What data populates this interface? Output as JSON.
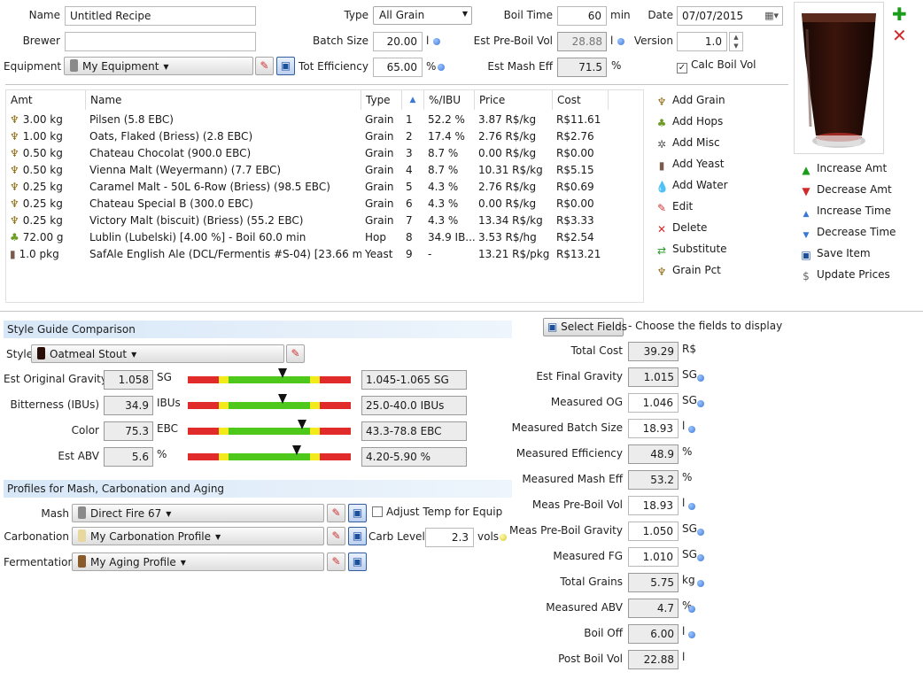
{
  "header": {
    "name_label": "Name",
    "name_value": "Untitled Recipe",
    "brewer_label": "Brewer",
    "brewer_value": "",
    "equipment_label": "Equipment",
    "equipment_value": "My Equipment",
    "type_label": "Type",
    "type_value": "All Grain",
    "batch_size_label": "Batch Size",
    "batch_size_value": "20.00",
    "batch_size_unit": "l",
    "tot_eff_label": "Tot Efficiency",
    "tot_eff_value": "65.00",
    "tot_eff_unit": "%",
    "boil_time_label": "Boil Time",
    "boil_time_value": "60",
    "boil_time_unit": "min",
    "pre_boil_label": "Est Pre-Boil Vol",
    "pre_boil_value": "28.88",
    "pre_boil_unit": "l",
    "mash_eff_label": "Est Mash Eff",
    "mash_eff_value": "71.5",
    "mash_eff_unit": "%",
    "date_label": "Date",
    "date_value": "07/07/2015",
    "version_label": "Version",
    "version_value": "1.0",
    "calc_boil_label": "Calc Boil Vol",
    "calc_boil_checked": "✓"
  },
  "ingredients": {
    "columns": [
      "Amt",
      "Name",
      "Type",
      "▲",
      "%/IBU",
      "Price",
      "Cost"
    ],
    "rows": [
      {
        "icon": "grain-icon",
        "amt": "3.00 kg",
        "name": "Pilsen (5.8 EBC)",
        "type": "Grain",
        "num": "1",
        "pct": "52.2 %",
        "price": "3.87 R$/kg",
        "cost": "R$11.61"
      },
      {
        "icon": "grain-icon",
        "amt": "1.00 kg",
        "name": "Oats, Flaked (Briess) (2.8 EBC)",
        "type": "Grain",
        "num": "2",
        "pct": "17.4 %",
        "price": "2.76 R$/kg",
        "cost": "R$2.76"
      },
      {
        "icon": "grain-icon",
        "amt": "0.50 kg",
        "name": "Chateau Chocolat (900.0 EBC)",
        "type": "Grain",
        "num": "3",
        "pct": "8.7 %",
        "price": "0.00 R$/kg",
        "cost": "R$0.00"
      },
      {
        "icon": "grain-icon",
        "amt": "0.50 kg",
        "name": "Vienna Malt (Weyermann) (7.7 EBC)",
        "type": "Grain",
        "num": "4",
        "pct": "8.7 %",
        "price": "10.31 R$/kg",
        "cost": "R$5.15"
      },
      {
        "icon": "grain-icon",
        "amt": "0.25 kg",
        "name": "Caramel Malt - 50L 6-Row (Briess) (98.5 EBC)",
        "type": "Grain",
        "num": "5",
        "pct": "4.3 %",
        "price": "2.76 R$/kg",
        "cost": "R$0.69"
      },
      {
        "icon": "grain-icon",
        "amt": "0.25 kg",
        "name": "Chateau Special B (300.0 EBC)",
        "type": "Grain",
        "num": "6",
        "pct": "4.3 %",
        "price": "0.00 R$/kg",
        "cost": "R$0.00"
      },
      {
        "icon": "grain-icon",
        "amt": "0.25 kg",
        "name": "Victory Malt (biscuit) (Briess) (55.2 EBC)",
        "type": "Grain",
        "num": "7",
        "pct": "4.3 %",
        "price": "13.34 R$/kg",
        "cost": "R$3.33"
      },
      {
        "icon": "hop-icon",
        "amt": "72.00 g",
        "name": "Lublin (Lubelski) [4.00 %] - Boil 60.0 min",
        "type": "Hop",
        "num": "8",
        "pct": "34.9 IB...",
        "price": "3.53 R$/hg",
        "cost": "R$2.54"
      },
      {
        "icon": "yeast-icon",
        "amt": "1.0 pkg",
        "name": "SafAle English Ale (DCL/Fermentis #S-04) [23.66 ml]",
        "type": "Yeast",
        "num": "9",
        "pct": "-",
        "price": "13.21 R$/pkg",
        "cost": "R$13.21"
      }
    ]
  },
  "actions": {
    "add_grain": "Add Grain",
    "add_hops": "Add Hops",
    "add_misc": "Add Misc",
    "add_yeast": "Add Yeast",
    "add_water": "Add Water",
    "edit": "Edit",
    "delete": "Delete",
    "substitute": "Substitute",
    "grain_pct": "Grain Pct",
    "increase_amt": "Increase Amt",
    "decrease_amt": "Decrease Amt",
    "increase_time": "Increase Time",
    "decrease_time": "Decrease Time",
    "save_item": "Save Item",
    "update_prices": "Update Prices"
  },
  "style_guide": {
    "section_title": "Style Guide Comparison",
    "style_label": "Style",
    "style_value": "Oatmeal Stout",
    "rows": [
      {
        "label": "Est Original Gravity",
        "value": "1.058",
        "unit": "SG",
        "range": "1.045-1.065 SG",
        "marker": 0.58
      },
      {
        "label": "Bitterness (IBUs)",
        "value": "34.9",
        "unit": "IBUs",
        "range": "25.0-40.0 IBUs",
        "marker": 0.58
      },
      {
        "label": "Color",
        "value": "75.3",
        "unit": "EBC",
        "range": "43.3-78.8 EBC",
        "marker": 0.7
      },
      {
        "label": "Est ABV",
        "value": "5.6",
        "unit": "%",
        "range": "4.20-5.90 %",
        "marker": 0.67
      }
    ]
  },
  "profiles": {
    "section_title": "Profiles for Mash, Carbonation and Aging",
    "mash_label": "Mash",
    "mash_value": "Direct Fire 67",
    "adjust_temp_label": "Adjust Temp for Equip",
    "carb_label": "Carbonation",
    "carb_value": "My Carbonation Profile",
    "carb_level_label": "Carb Level",
    "carb_level_value": "2.3",
    "carb_level_unit": "vols",
    "ferm_label": "Fermentation",
    "ferm_value": "My Aging Profile"
  },
  "fields": {
    "select_button": "Select Fields",
    "hint": "- Choose the fields to display",
    "rows": [
      {
        "label": "Total Cost",
        "value": "39.29",
        "unit": "R$",
        "editable": false,
        "dot": false
      },
      {
        "label": "Est Final Gravity",
        "value": "1.015",
        "unit": "SG",
        "editable": false,
        "dot": true
      },
      {
        "label": "Measured OG",
        "value": "1.046",
        "unit": "SG",
        "editable": true,
        "dot": true
      },
      {
        "label": "Measured Batch Size",
        "value": "18.93",
        "unit": "l",
        "editable": true,
        "dot": true
      },
      {
        "label": "Measured Efficiency",
        "value": "48.9",
        "unit": "%",
        "editable": false,
        "dot": false
      },
      {
        "label": "Measured Mash Eff",
        "value": "53.2",
        "unit": "%",
        "editable": false,
        "dot": false
      },
      {
        "label": "Meas Pre-Boil Vol",
        "value": "18.93",
        "unit": "l",
        "editable": true,
        "dot": true
      },
      {
        "label": "Meas Pre-Boil Gravity",
        "value": "1.050",
        "unit": "SG",
        "editable": true,
        "dot": true
      },
      {
        "label": "Measured FG",
        "value": "1.010",
        "unit": "SG",
        "editable": true,
        "dot": true
      },
      {
        "label": "Total Grains",
        "value": "5.75",
        "unit": "kg",
        "editable": false,
        "dot": true
      },
      {
        "label": "Measured ABV",
        "value": "4.7",
        "unit": "%",
        "editable": false,
        "dot": true
      },
      {
        "label": "Boil Off",
        "value": "6.00",
        "unit": "l",
        "editable": false,
        "dot": true
      },
      {
        "label": "Post Boil Vol",
        "value": "22.88",
        "unit": "l",
        "editable": false,
        "dot": false
      }
    ]
  },
  "colors": {
    "beer": "#2a0f08",
    "accent": "#3a78d8",
    "bar_green": "#4fc81c",
    "bar_red": "#e12a2a",
    "bar_yellow": "#f3ea1b"
  }
}
